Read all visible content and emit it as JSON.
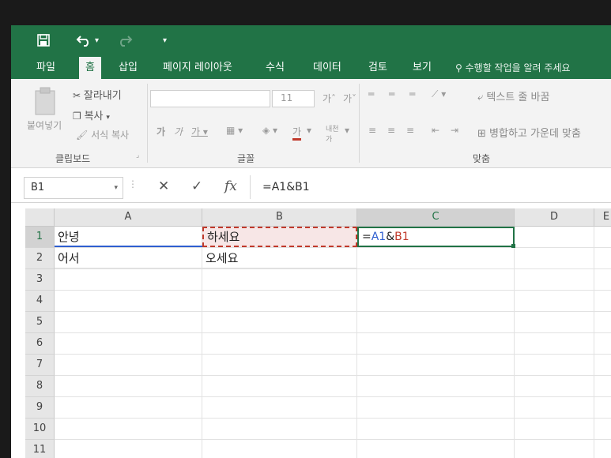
{
  "quick_access": {
    "save_icon": "save-icon",
    "undo_icon": "undo-icon",
    "redo_icon": "redo-icon",
    "customize_icon": "customize-icon"
  },
  "tabs": [
    {
      "label": "파일"
    },
    {
      "label": "홈"
    },
    {
      "label": "삽입"
    },
    {
      "label": "페이지 레이아웃"
    },
    {
      "label": "수식"
    },
    {
      "label": "데이터"
    },
    {
      "label": "검토"
    },
    {
      "label": "보기"
    }
  ],
  "tell_me": "수행할 작업을 알려 주세요",
  "ribbon": {
    "clipboard": {
      "paste": "붙여넣기",
      "cut": "잘라내기",
      "copy": "복사",
      "format_painter": "서식 복사",
      "group": "클립보드"
    },
    "font": {
      "size": "11",
      "group": "글꼴"
    },
    "alignment": {
      "wrap_text": "텍스트 줄 바꿈",
      "merge_center": "병합하고 가운데 맞춤",
      "group": "맞춤"
    }
  },
  "formula_bar": {
    "name_box": "B1",
    "formula": "=A1&B1",
    "fx_label": "fx"
  },
  "columns": [
    "A",
    "B",
    "C",
    "D",
    "E"
  ],
  "rows": [
    "1",
    "2",
    "3",
    "4",
    "5",
    "6",
    "7",
    "8",
    "9",
    "10",
    "11"
  ],
  "cells": {
    "A1": "안녕",
    "A2": "어서",
    "B1": "하세요",
    "B2": "오세요",
    "C1_eq": "=",
    "C1_ref1": "A1",
    "C1_amp": "&",
    "C1_ref2": "B1"
  },
  "colors": {
    "excel_green": "#217346",
    "ref_blue": "#2f5fd0",
    "ref_red": "#c0392b"
  }
}
